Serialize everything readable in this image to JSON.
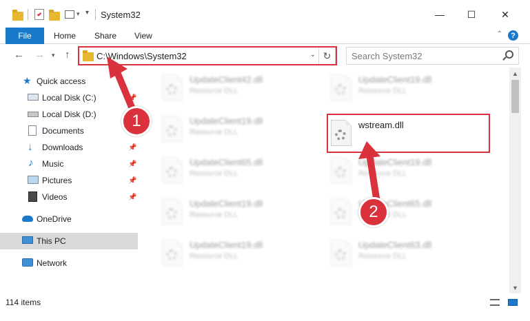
{
  "window": {
    "title": "System32"
  },
  "title_buttons": {
    "minimize": "—",
    "maximize": "☐",
    "close": "✕"
  },
  "ribbon": {
    "file_tab": "File",
    "tabs": [
      "Home",
      "Share",
      "View"
    ],
    "help": "?"
  },
  "address": {
    "path": "C:\\Windows\\System32",
    "search_placeholder": "Search System32"
  },
  "sidebar": {
    "items": [
      {
        "label": "Quick access",
        "icon": "star-icon",
        "pinned": false
      },
      {
        "label": "Local Disk (C:)",
        "icon": "drive-icon",
        "pinned": true
      },
      {
        "label": "Local Disk (D:)",
        "icon": "drive-icon",
        "pinned": true
      },
      {
        "label": "Documents",
        "icon": "documents-icon",
        "pinned": true
      },
      {
        "label": "Downloads",
        "icon": "download-icon",
        "pinned": true
      },
      {
        "label": "Music",
        "icon": "music-icon",
        "pinned": true
      },
      {
        "label": "Pictures",
        "icon": "pictures-icon",
        "pinned": true
      },
      {
        "label": "Videos",
        "icon": "videos-icon",
        "pinned": true
      },
      {
        "label": "OneDrive",
        "icon": "cloud-icon",
        "pinned": false
      },
      {
        "label": "This PC",
        "icon": "computer-icon",
        "pinned": false
      },
      {
        "label": "Network",
        "icon": "network-icon",
        "pinned": false
      }
    ]
  },
  "files": [
    {
      "name": "UpdateClient42.dll",
      "type": "Resource DLL"
    },
    {
      "name": "UpdateClient19.dll",
      "type": "Resource DLL"
    },
    {
      "name": "UpdateClient19.dll",
      "type": "Resource DLL"
    },
    {
      "name": "wstream.dll",
      "type": ""
    },
    {
      "name": "UpdateClient65.dll",
      "type": "Resource DLL"
    },
    {
      "name": "UpdateClient19.dll",
      "type": "Resource DLL"
    },
    {
      "name": "UpdateClient19.dll",
      "type": "Resource DLL"
    },
    {
      "name": "UpdateClient65.dll",
      "type": "Resource DLL"
    },
    {
      "name": "UpdateClient19.dll",
      "type": "Resource DLL"
    },
    {
      "name": "UpdateClient63.dll",
      "type": "Resource DLL"
    }
  ],
  "status": {
    "item_count": "114 items"
  },
  "callouts": {
    "step1": "1",
    "step2": "2"
  },
  "colors": {
    "accent": "#1979ca",
    "highlight_red": "#d9323d",
    "selected": "#d9d9d9"
  }
}
